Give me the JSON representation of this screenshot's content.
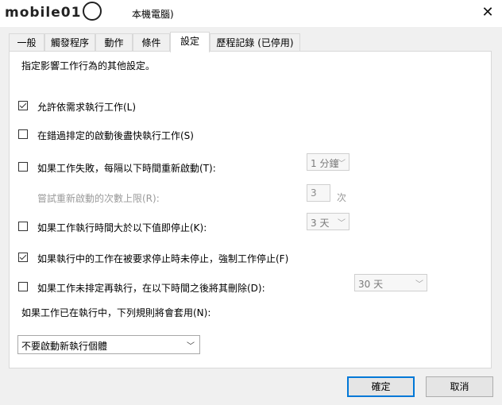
{
  "window": {
    "watermark": "mobile01",
    "title_suffix": "本機電腦)",
    "close_glyph": "✕"
  },
  "tabs": [
    {
      "label": "一般",
      "active": false
    },
    {
      "label": "觸發程序",
      "active": false
    },
    {
      "label": "動作",
      "active": false
    },
    {
      "label": "條件",
      "active": false
    },
    {
      "label": "設定",
      "active": true
    },
    {
      "label": "歷程記錄 (已停用)",
      "active": false
    }
  ],
  "settings": {
    "description": "指定影響工作行為的其他設定。",
    "allow_on_demand": {
      "label": "允許依需求執行工作(L)",
      "checked": true
    },
    "run_after_missed": {
      "label": "在錯過排定的啟動後盡快執行工作(S)",
      "checked": false
    },
    "restart_on_fail": {
      "label": "如果工作失敗，每隔以下時間重新啟動(T):",
      "checked": false,
      "interval": "1 分鐘"
    },
    "restart_attempts": {
      "label": "嘗試重新啟動的次數上限(R):",
      "value": "3",
      "unit": "次"
    },
    "stop_if_runs_longer": {
      "label": "如果工作執行時間大於以下值即停止(K):",
      "checked": false,
      "duration": "3 天"
    },
    "force_stop": {
      "label": "如果執行中的工作在被要求停止時未停止，強制工作停止(F)",
      "checked": true
    },
    "delete_if_not_scheduled": {
      "label": "如果工作未排定再執行，在以下時間之後將其刪除(D):",
      "checked": false,
      "duration": "30 天"
    },
    "running_rule_label": "如果工作已在執行中，下列規則將會套用(N):",
    "running_rule_value": "不要啟動新執行個體"
  },
  "buttons": {
    "ok": "確定",
    "cancel": "取消"
  },
  "colors": {
    "accent": "#0078d7",
    "panel": "#ffffff",
    "background": "#f0f0f0"
  }
}
